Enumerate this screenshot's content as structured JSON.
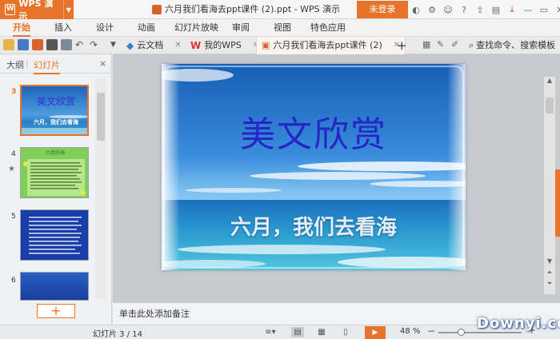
{
  "app": {
    "name": "WPS 演示",
    "logo": "W"
  },
  "document": {
    "title": "六月我们看海去ppt课件 (2).ppt - WPS 演示"
  },
  "login_label": "未登录",
  "menu": [
    "开始",
    "插入",
    "设计",
    "动画",
    "幻灯片放映",
    "审阅",
    "视图",
    "特色应用"
  ],
  "tabs": {
    "cloud_docs": "云文档",
    "my_wps": "我的WPS",
    "current": "六月我们看海去ppt课件 (2)",
    "add": "+"
  },
  "search_command": "查找命令、搜索模板",
  "panel": {
    "tab_outline": "大纲",
    "tab_slides": "幻灯片",
    "close": "×",
    "add": "+",
    "thumbnails": [
      {
        "number": "3",
        "title": "美文欣赏",
        "subtitle": "六月，我们去看海"
      },
      {
        "number": "4",
        "title": "六月的海"
      },
      {
        "number": "5"
      },
      {
        "number": "6"
      }
    ]
  },
  "slide": {
    "title": "美文欣赏",
    "subtitle": "六月，我们去看海"
  },
  "notes_placeholder": "单击此处添加备注",
  "status": {
    "slide_label": "幻灯片",
    "current": 3,
    "total": 14,
    "slide_count_text": "幻灯片 3 / 14",
    "zoom_text": "48 %",
    "zoom_value": 48,
    "zoom_minus": "−",
    "zoom_plus": "+"
  },
  "watermark": "Downyi.com",
  "colors": {
    "accent": "#e8742b",
    "slide_title": "#2525c8"
  }
}
